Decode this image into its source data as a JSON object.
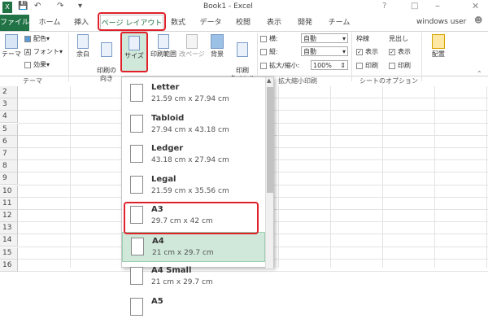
{
  "title": "Book1 - Excel",
  "user": "windows user",
  "tabs": [
    "ファイル",
    "ホーム",
    "挿入",
    "ページ レイアウト",
    "数式",
    "データ",
    "校閲",
    "表示",
    "開発",
    "チーム"
  ],
  "ribbon": {
    "theme": {
      "btn": "テーマ",
      "colors": "配色",
      "fonts": "フォント",
      "effects": "効果",
      "group": "テーマ"
    },
    "margins": "余白",
    "orientation": "印刷の\n向き",
    "size": "サイズ",
    "print_area": "印刷範囲",
    "breaks": "改ページ",
    "background": "背景",
    "print_titles": "印刷\nタイトル",
    "scale": {
      "width_label": "横:",
      "width_val": "自動",
      "height_label": "縦:",
      "height_val": "自動",
      "scale_label": "拡大/縮小:",
      "scale_val": "100%",
      "group": "拡大縮小印刷"
    },
    "sheet_opts": {
      "gridlines": "枠線",
      "headings": "見出し",
      "view": "表示",
      "print": "印刷",
      "group": "シートのオプション"
    },
    "arrange": "配置"
  },
  "rows": [
    "2",
    "3",
    "4",
    "5",
    "6",
    "7",
    "8",
    "9",
    "10",
    "11",
    "12",
    "13",
    "14",
    "15",
    "16"
  ],
  "paper_sizes": [
    {
      "name": "Letter",
      "size": "21.59 cm x 27.94 cm"
    },
    {
      "name": "Tabloid",
      "size": "27.94 cm x 43.18 cm"
    },
    {
      "name": "Ledger",
      "size": "43.18 cm x 27.94 cm"
    },
    {
      "name": "Legal",
      "size": "21.59 cm x 35.56 cm"
    },
    {
      "name": "A3",
      "size": "29.7 cm x 42 cm"
    },
    {
      "name": "A4",
      "size": "21 cm x 29.7 cm"
    },
    {
      "name": "A4 Small",
      "size": "21 cm x 29.7 cm"
    },
    {
      "name": "A5",
      "size": ""
    }
  ],
  "selected_paper": "A4",
  "colors": {
    "accent": "#217346",
    "highlight": "#e0202a",
    "selection": "#cfe8d9"
  }
}
